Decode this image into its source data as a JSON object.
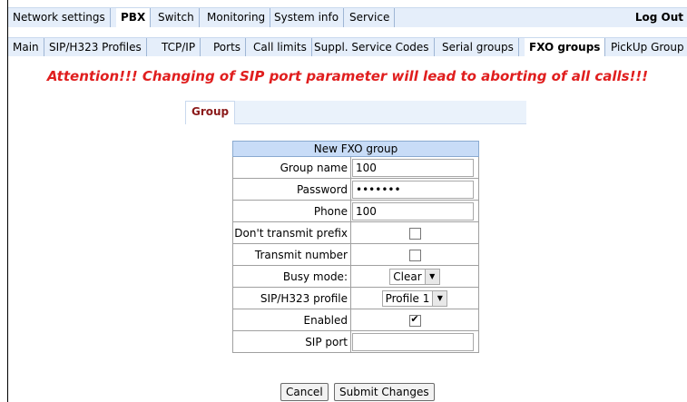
{
  "top_menu": {
    "items": [
      "Network settings",
      "PBX",
      "Switch",
      "Monitoring",
      "System info",
      "Service"
    ],
    "active": "PBX",
    "logout": "Log Out"
  },
  "sub_menu": {
    "items": [
      "Main",
      "SIP/H323 Profiles",
      "TCP/IP",
      "Ports",
      "Call limits",
      "Suppl. Service Codes",
      "Serial groups",
      "FXO groups",
      "PickUp Group"
    ],
    "active": "FXO groups"
  },
  "warning": "Attention!!! Changing of SIP port parameter will lead to aborting of all calls!!!",
  "tab": {
    "label": "Group"
  },
  "form": {
    "title": "New FXO group",
    "group_name_label": "Group name",
    "group_name_value": "100",
    "password_label": "Password",
    "password_value": "1234567",
    "phone_label": "Phone",
    "phone_value": "100",
    "dont_transmit_prefix_label": "Don't transmit prefix",
    "dont_transmit_prefix_checked": false,
    "transmit_number_label": "Transmit number",
    "transmit_number_checked": false,
    "busy_mode_label": "Busy mode:",
    "busy_mode_value": "Clear",
    "sip_profile_label": "SIP/H323 profile",
    "sip_profile_value": "Profile 1",
    "enabled_label": "Enabled",
    "enabled_checked": true,
    "enabled_mark": "✔",
    "sip_port_label": "SIP port",
    "sip_port_value": ""
  },
  "buttons": {
    "cancel": "Cancel",
    "submit": "Submit Changes"
  },
  "icons": {
    "select_arrow": "▼"
  }
}
